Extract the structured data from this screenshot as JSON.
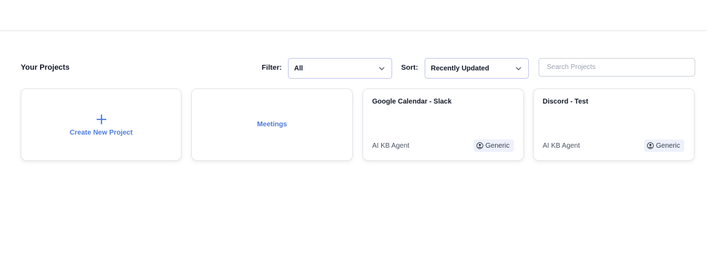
{
  "header": {
    "title": "Your Projects"
  },
  "controls": {
    "filter_label": "Filter:",
    "filter_value": "All",
    "sort_label": "Sort:",
    "sort_value": "Recently Updated",
    "search_placeholder": "Search Projects"
  },
  "create_card": {
    "label": "Create New Project",
    "icon": "plus-icon"
  },
  "meetings_card": {
    "label": "Meetings"
  },
  "projects": [
    {
      "title": "Google Calendar - Slack",
      "type": "AI KB Agent",
      "badge": "Generic",
      "badge_icon": "user-circle-icon"
    },
    {
      "title": "Discord - Test",
      "type": "AI KB Agent",
      "badge": "Generic",
      "badge_icon": "user-circle-icon"
    }
  ],
  "colors": {
    "accent": "#4f7ddb",
    "badge_bg": "#eef1fb",
    "select_border": "#c7c9f2"
  }
}
